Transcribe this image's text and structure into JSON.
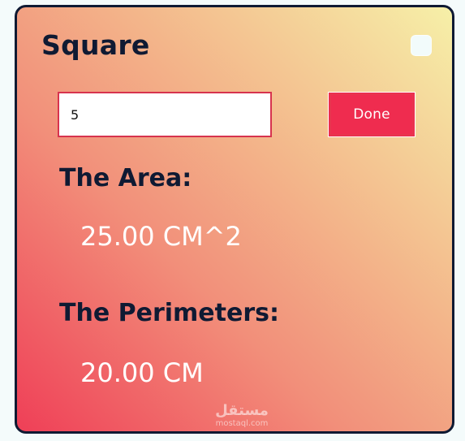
{
  "card": {
    "title": "Square",
    "checkbox_checked": false
  },
  "input": {
    "value": "5",
    "placeholder": ""
  },
  "done_button": {
    "label": "Done"
  },
  "area": {
    "heading": "The Area:",
    "value": "25.00 CM^2"
  },
  "perimeter": {
    "heading": "The Perimeters:",
    "value": "20.00 CM"
  },
  "watermark": {
    "arabic": "مستقل",
    "latin": "mostaql.com"
  },
  "colors": {
    "heading": "#0f1a33",
    "value_text": "#ffffff",
    "button_bg": "#ef2c4f",
    "input_border": "#d7334e",
    "gradient_top_right": "#f6f0a8",
    "gradient_bottom_left": "#ef3f57"
  }
}
